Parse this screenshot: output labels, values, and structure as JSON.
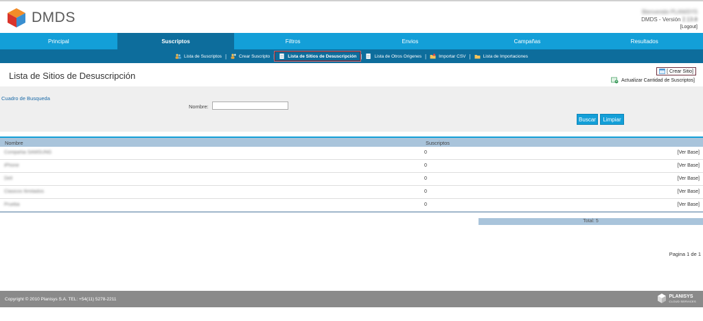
{
  "app": {
    "brand": "DMDS",
    "user_name": "Bienvenido PLANISYS",
    "version_label": "DMDS - Versión",
    "version_number": "2.13.8",
    "logout": "[Logout]"
  },
  "main_nav": [
    {
      "label": "Principal",
      "active": false
    },
    {
      "label": "Suscriptos",
      "active": true
    },
    {
      "label": "Filtros",
      "active": false
    },
    {
      "label": "Envios",
      "active": false
    },
    {
      "label": "Campañas",
      "active": false
    },
    {
      "label": "Resultados",
      "active": false
    }
  ],
  "sub_nav": [
    {
      "label": "Lista de Suscriptos",
      "icon": "users-icon"
    },
    {
      "label": "Crear Suscripto",
      "icon": "add-user-icon"
    },
    {
      "label": "Lista de Sitios de Desuscripción",
      "icon": "document-icon",
      "active": true
    },
    {
      "label": "Lista de Otros Origenes",
      "icon": "document-icon"
    },
    {
      "label": "Importar CSV",
      "icon": "folder-icon"
    },
    {
      "label": "Lista de Importaciones",
      "icon": "folder-icon"
    }
  ],
  "page": {
    "title": "Lista de Sitios de Desuscripción",
    "crear_sitio": "[ Crear Sitio]",
    "actualizar": "Actualizar Cantidad de Suscriptos]"
  },
  "search": {
    "title": "Cuadro de Busqueda",
    "nombre_label": "Nombre:",
    "nombre_value": "",
    "buscar": "Buscar",
    "limpiar": "Limpiar"
  },
  "table": {
    "headers": [
      "Nombre",
      "Suscriptos"
    ],
    "rows": [
      {
        "name": "Compañia SAMSUNG",
        "count": "0",
        "action": "[Ver Base]"
      },
      {
        "name": "iPhone",
        "count": "0",
        "action": "[Ver Base]"
      },
      {
        "name": "Dell",
        "count": "0",
        "action": "[Ver Base]"
      },
      {
        "name": "Clasicos Ilimitados",
        "count": "0",
        "action": "[Ver Base]"
      },
      {
        "name": "Prueba",
        "count": "0",
        "action": "[Ver Base]"
      }
    ],
    "total": "Total: 5",
    "pagination": "Pagina 1 de 1"
  },
  "footer": {
    "copyright": "Copyright © 2010 Planisys S.A. TEL: +54(11) 5278-2211",
    "brand": "PLANISYS",
    "brand_sub": "CLOUD SERVICES"
  },
  "colors": {
    "nav_blue": "#139fd8",
    "nav_dark": "#0d6d9c",
    "table_header": "#a9c4db",
    "footer": "#8a8a8a",
    "highlight_border": "#6b2b3a"
  }
}
